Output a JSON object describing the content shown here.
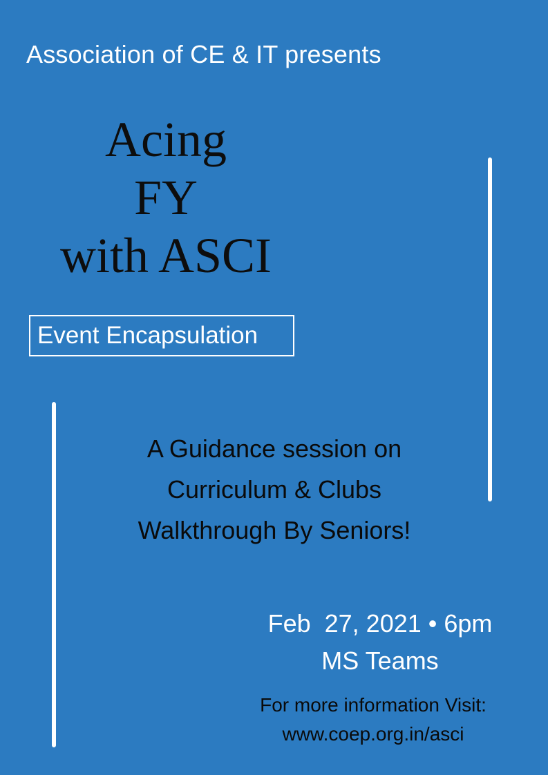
{
  "presenter": "Association of CE & IT presents",
  "title_lines": [
    "Acing",
    "FY",
    "with ASCI"
  ],
  "badge": "Event Encapsulation",
  "description_lines": [
    "A Guidance session on",
    "Curriculum & Clubs",
    "Walkthrough By Seniors!"
  ],
  "date_time": "Feb  27, 2021 • 6pm",
  "platform": "MS Teams",
  "info_label": "For more information Visit:",
  "info_url": "www.coep.org.in/asci",
  "colors": {
    "background": "#2c7bc1",
    "accent": "#ffffff",
    "dark_text": "#0d0d0d"
  }
}
